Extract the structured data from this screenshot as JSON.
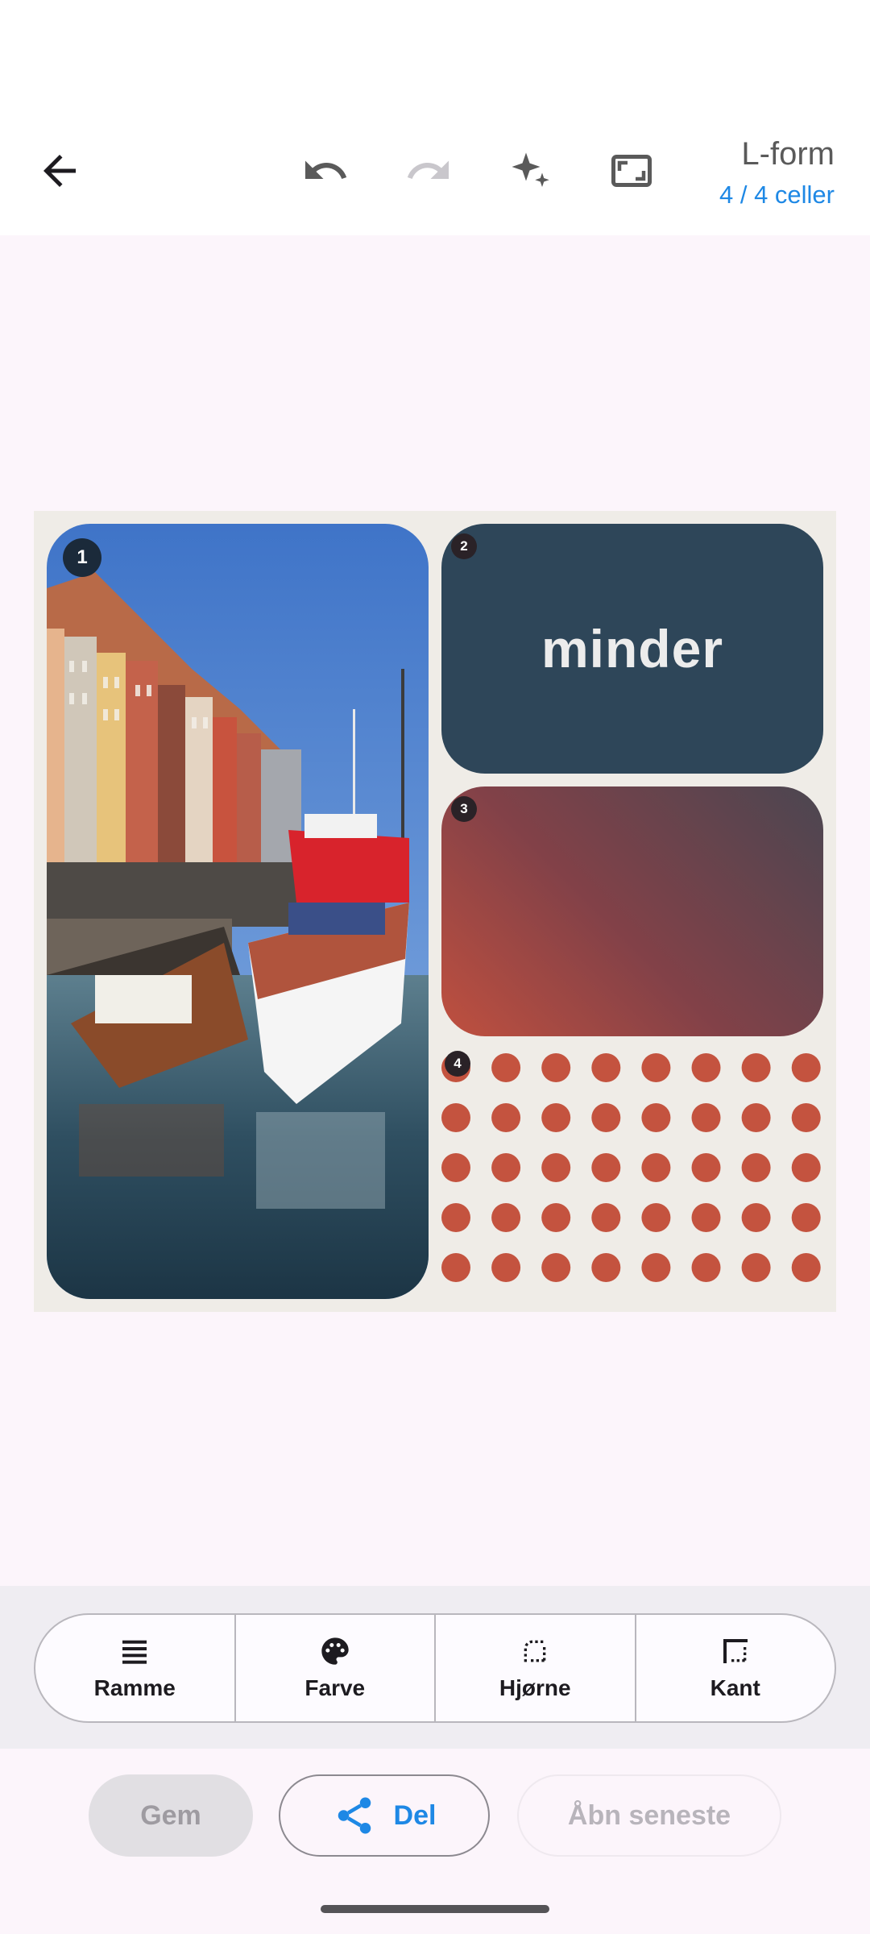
{
  "toolbar": {
    "back_icon": "arrow-left-icon",
    "undo_icon": "undo-icon",
    "redo_icon": "redo-icon",
    "magic_icon": "sparkles-icon",
    "aspect_icon": "aspect-ratio-icon",
    "layout_title": "L-form",
    "cell_count": "4 / 4 celler"
  },
  "collage": {
    "cells": [
      {
        "number": "1",
        "kind": "photo"
      },
      {
        "number": "2",
        "kind": "text",
        "text": "minder",
        "background": "#2e4659"
      },
      {
        "number": "3",
        "kind": "gradient"
      },
      {
        "number": "4",
        "kind": "pattern",
        "dot_color": "#c4533f"
      }
    ]
  },
  "tools": [
    {
      "label": "Ramme",
      "icon": "frame-lines-icon"
    },
    {
      "label": "Farve",
      "icon": "palette-icon"
    },
    {
      "label": "Hjørne",
      "icon": "rounded-corner-icon"
    },
    {
      "label": "Kant",
      "icon": "border-edge-icon"
    }
  ],
  "actions": {
    "save": "Gem",
    "share": "Del",
    "open_recent": "Åbn seneste"
  },
  "colors": {
    "accent": "#1e88e5",
    "background": "#fcf5fb",
    "canvas": "#efece7"
  }
}
